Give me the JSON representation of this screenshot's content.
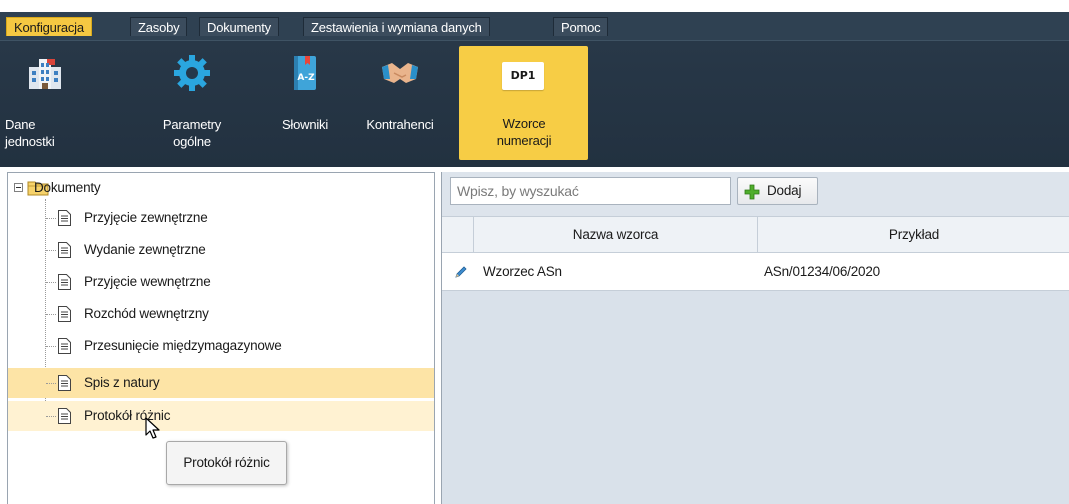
{
  "menu": {
    "tabs": [
      {
        "label": "Konfiguracja",
        "active": true
      },
      {
        "label": "Zasoby",
        "active": false
      },
      {
        "label": "Dokumenty",
        "active": false
      },
      {
        "label": "Zestawienia i wymiana danych",
        "active": false
      },
      {
        "label": "Pomoc",
        "active": false
      }
    ]
  },
  "ribbon": {
    "buttons": [
      {
        "label": "Dane jednostki",
        "icon": "building-icon",
        "active": false
      },
      {
        "label": "Parametry ogólne",
        "icon": "gear-icon",
        "active": false
      },
      {
        "label": "Słowniki",
        "icon": "dictionary-book-icon",
        "active": false
      },
      {
        "label": "Kontrahenci",
        "icon": "handshake-icon",
        "active": false
      },
      {
        "label": "Wzorce numeracji",
        "icon": "dp1-template-icon",
        "icon_text": "DP1",
        "active": true
      }
    ]
  },
  "tree": {
    "root": {
      "label": "Dokumenty",
      "icon": "folder-icon",
      "expanded": true
    },
    "items": [
      {
        "label": "Przyjęcie zewnętrzne",
        "state": "normal"
      },
      {
        "label": "Wydanie zewnętrzne",
        "state": "normal"
      },
      {
        "label": "Przyjęcie wewnętrzne",
        "state": "normal"
      },
      {
        "label": "Rozchód wewnętrzny",
        "state": "normal"
      },
      {
        "label": "Przesunięcie międzymagazynowe",
        "state": "normal"
      },
      {
        "label": "Spis z natury",
        "state": "selected"
      },
      {
        "label": "Protokół różnic",
        "state": "hover"
      }
    ],
    "tooltip": "Protokół różnic"
  },
  "search": {
    "placeholder": "Wpisz, by wyszukać",
    "value": ""
  },
  "add_button": {
    "label": "Dodaj"
  },
  "table": {
    "columns": [
      "Nazwa wzorca",
      "Przykład"
    ],
    "rows": [
      {
        "name": "Wzorzec ASn",
        "example": "ASn/01234/06/2020"
      }
    ]
  },
  "colors": {
    "accent": "#f5c842",
    "ribbon_bg": "#26364a",
    "selected_row": "#fde4a6",
    "hover_row": "#fff2d2"
  }
}
